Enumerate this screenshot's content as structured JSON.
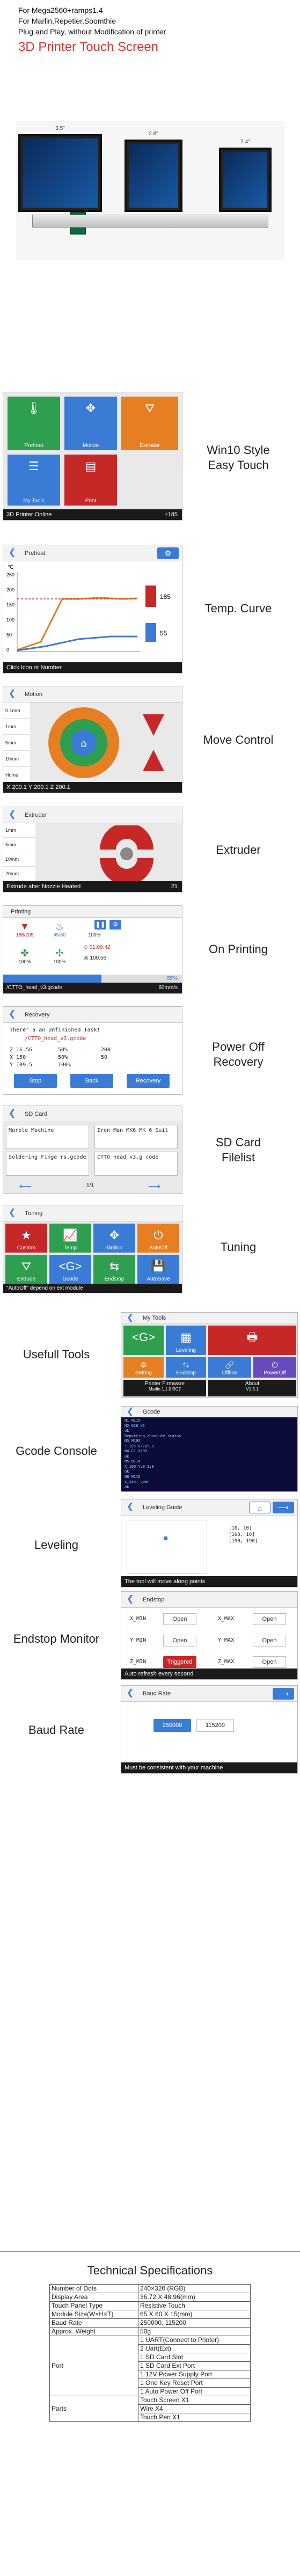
{
  "header": {
    "lines": [
      "For Mega2560+ramps1.4",
      "For Marlin,Repetier,Soomthie",
      "Plug and Play, without Modification of printer"
    ],
    "title": "3D Printer Touch Screen",
    "sizes": [
      "3.5\"",
      "2.8\"",
      "2.4\""
    ]
  },
  "features": {
    "win10": {
      "label": "Win10 Style\nEasy Touch",
      "tiles": [
        "Preheat",
        "Motion",
        "Extruder",
        "My Tools",
        "Print",
        ""
      ],
      "status_left": "3D Printer Online",
      "status_right": "±185"
    },
    "temp": {
      "label": "Temp. Curve",
      "title": "Preheat",
      "unit": "℃",
      "yticks": [
        "250",
        "200",
        "150",
        "100",
        "50",
        "0"
      ],
      "readout_top": "185",
      "readout_bottom": "55",
      "status": "Click Icon or Number"
    },
    "motion": {
      "label": "Move Control",
      "title": "Motion",
      "steps": [
        "0.1mm",
        "1mm",
        "5mm",
        "10mm",
        "Home"
      ],
      "status": "X 200.1  Y 200.1  Z 200.1"
    },
    "extruder": {
      "label": "Extruder",
      "title": "Extruder",
      "steps": [
        "1mm",
        "5mm",
        "10mm",
        "20mm"
      ],
      "status": "Extrude after Nozzle Heated",
      "status_right": "21"
    },
    "printing": {
      "label": "On Printing",
      "title": "Printing",
      "cells": [
        {
          "icon": "nozzle-icon",
          "value": "186/205"
        },
        {
          "icon": "bed-icon",
          "value": "45/60"
        },
        {
          "icon": "speed-icon",
          "value": "100%"
        },
        {
          "icon": "fan-icon",
          "value": "100%"
        },
        {
          "icon": "flow-icon",
          "value": "100%"
        },
        {
          "icon": "layer-icon",
          "value": "100%"
        }
      ],
      "time": "01:09:42",
      "z": "100.56",
      "progress": "55%",
      "progress_value": 0.55,
      "file": "/CTTO_head_v3.gcode",
      "speed": "60mm/s"
    },
    "recovery": {
      "label": "Power Off\nRecovery",
      "title": "Recovery",
      "message": "There' a an Unfinished Task!",
      "file": "/CTTO_head_v3.gcode",
      "rows": [
        [
          "Z 16.56",
          "50%",
          "200"
        ],
        [
          "X 150",
          "50%",
          "50"
        ],
        [
          "Y 109.5",
          "100%",
          ""
        ]
      ],
      "buttons": [
        "Stop",
        "Back",
        "Recovery"
      ]
    },
    "sdcard": {
      "label": "SD Card\nFilelist",
      "title": "SD Card",
      "files": [
        "Marble Machine",
        "Iron Man MK6 MK 6 Suit",
        "Soldering Finge rs.gcode",
        "CTTO_head_v3.g code"
      ],
      "page": "1/1"
    },
    "tuning": {
      "label": "Tuning",
      "title": "Tuning",
      "tiles": [
        "Custom",
        "Temp",
        "Motion",
        "AutoOff",
        "Extrude",
        "Gcode",
        "Endstop",
        "AutoSave"
      ],
      "status": "\"AutoOff\" depend on ext module"
    },
    "tools": {
      "label": "Usefull Tools",
      "title": "My Tools",
      "tiles": [
        "G>",
        "Leveling",
        "",
        "Setting",
        "Endstop",
        "Offline",
        "PowerOff"
      ],
      "firmware_label": "Printer Firmware",
      "firmware_value": "Marlin 1.1.0 RC7",
      "about_label": "About",
      "about_value": "V1.3.1"
    },
    "gcode": {
      "label": "Gcode Console",
      "title": "Gcode",
      "lines": [
        "N1 M115",
        "N2 G28 X1",
        "ok",
        "Reporting absolute status",
        "N3 M105",
        "T:185.0/185.0",
        "N4 G1 X100",
        "ok",
        "N5 M114",
        "X:100 Y:0 Z:0",
        "ok",
        "N6 M119",
        "x_min: open",
        "ok"
      ]
    },
    "leveling": {
      "label": "Leveling",
      "title": "Leveling Guide",
      "coords": [
        "[10, 10]",
        "[190, 10]",
        "[190, 190]"
      ],
      "status": "The tool will move along points"
    },
    "endstop": {
      "label": "Endstop Monitor",
      "title": "Endstop",
      "rows": [
        [
          "X_MIN",
          "Open",
          "X_MAX",
          "Open"
        ],
        [
          "Y_MIN",
          "Open",
          "Y_MAX",
          "Open"
        ],
        [
          "Z_MIN",
          "Triggered",
          "Z_MAX",
          "Open"
        ]
      ],
      "status": "Auto refresh every second"
    },
    "baud": {
      "label": "Baud Rate",
      "title": "Baud Rate",
      "options": [
        "250000",
        "115200"
      ],
      "status": "Must be consistent with your machine"
    }
  },
  "specs": {
    "title": "Technical Specifications",
    "rows": [
      {
        "k": "Number of Dots",
        "v": [
          "240×320 (RGB)"
        ]
      },
      {
        "k": "Display Area",
        "v": [
          "36.72 X 48.96(mm)"
        ]
      },
      {
        "k": "Touch Panel Type",
        "v": [
          "Resistive Touch"
        ]
      },
      {
        "k": "Module Size(W×H×T)",
        "v": [
          "65 X 60 X 15(mm)"
        ]
      },
      {
        "k": "Baud Rate",
        "v": [
          "250000, 115200"
        ]
      },
      {
        "k": "Approx. Weight",
        "v": [
          "50g"
        ]
      },
      {
        "k": "Port",
        "v": [
          "1 UART(Connect to Printer)",
          "2 Uart(Ext)",
          "1 SD Card Slot",
          "1 SD Card Ext Port",
          "1 12V Power Supply Port",
          "1 One Key Reset Port",
          "1 Auto Power Off Port"
        ]
      },
      {
        "k": "Parts",
        "v": [
          "Touch Screen X1",
          "Wire X4",
          "Touch Pen X1"
        ]
      }
    ]
  },
  "colors": {
    "accent_red": "#d9342b",
    "tile_green": "#2e9e4f",
    "tile_blue": "#3a7bd5",
    "tile_orange": "#e67e22",
    "tile_red": "#c62828",
    "tile_purple": "#6a4bbd"
  }
}
